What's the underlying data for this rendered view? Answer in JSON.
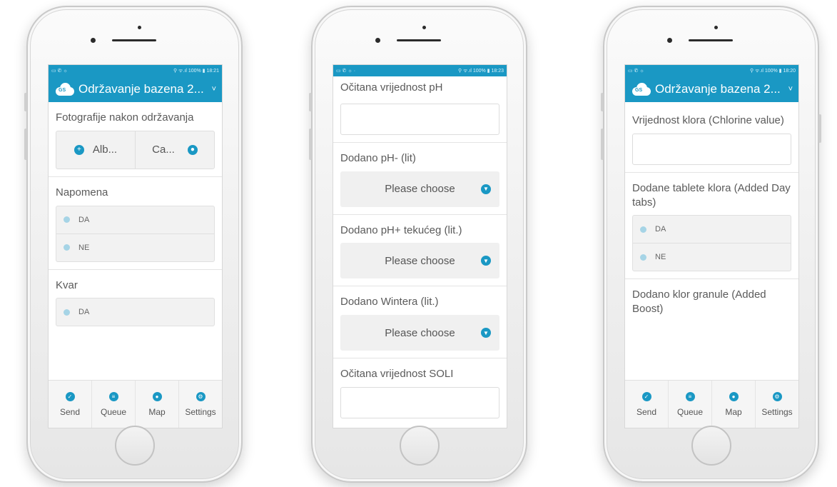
{
  "app": {
    "title": "Održavanje bazena 2...",
    "chevron": "˅",
    "logo_text": "GS",
    "status_left_1": "▭ ✆ ☼",
    "status_right_1": "⚲ ᯤ.ıl 100% ▮ 18:21",
    "status_left_2": "▭ ✆ ☼ ·",
    "status_right_2": "⚲ ᯤ.ıl 100% ▮ 18:23",
    "status_left_3": "▭ ✆ ☼",
    "status_right_3": "⚲ ᯤ.ıl 100% ▮ 18:20"
  },
  "nav": {
    "send": "Send",
    "queue": "Queue",
    "map": "Map",
    "settings": "Settings",
    "icons": [
      "check-icon",
      "list-icon",
      "map-pin-icon",
      "gear-icon"
    ]
  },
  "phone1": {
    "photo_label": "Fotografije nakon održavanja",
    "album_btn": "Alb...",
    "camera_btn": "Ca...",
    "note_label": "Napomena",
    "note_opt1": "DA",
    "note_opt2": "NE",
    "fault_label": "Kvar",
    "fault_opt1": "DA"
  },
  "phone2": {
    "ph_label": "Očitana vrijednost pH",
    "ph_minus_label": "Dodano pH- (lit)",
    "ph_plus_label": "Dodano pH+ tekućeg (lit.)",
    "wintera_label": "Dodano Wintera (lit.)",
    "salt_label": "Očitana vrijednost SOLI",
    "choose": "Please choose"
  },
  "phone3": {
    "chlorine_label": "Vrijednost klora (Chlorine value)",
    "tabs_label": "Dodane tablete klora (Added Day tabs)",
    "tabs_opt1": "DA",
    "tabs_opt2": "NE",
    "granule_label": "Dodano klor granule (Added Boost)"
  },
  "colors": {
    "accent": "#1a98c4"
  }
}
